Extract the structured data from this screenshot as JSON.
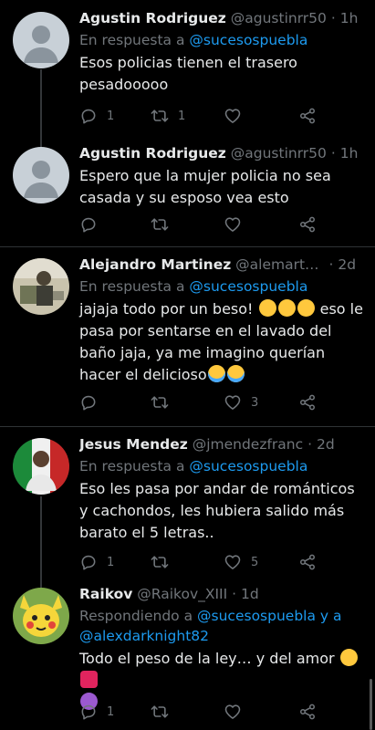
{
  "tweets": [
    {
      "name": "Agustin Rodriguez",
      "handle": "@agustinrr50",
      "sep": "·",
      "time": "1h",
      "reply_prefix": "En respuesta a",
      "reply_to": "@sucesospuebla",
      "text": "Esos policias tienen el trasero pesadooooo",
      "replies": "1",
      "retweets": "1",
      "likes": ""
    },
    {
      "name": "Agustin Rodriguez",
      "handle": "@agustinrr50",
      "sep": "·",
      "time": "1h",
      "text": "Espero que  la mujer policia no sea casada y su esposo vea esto",
      "replies": "",
      "retweets": "",
      "likes": ""
    },
    {
      "name": "Alejandro Martinez",
      "handle": "@alemart…",
      "sep": "·",
      "time": "2d",
      "reply_prefix": "En respuesta a",
      "reply_to": "@sucesospuebla",
      "text_a": "jajaja todo por un beso! ",
      "text_b": " eso le pasa por sentarse en el lavado del baño jaja, ya me imagino querían hacer el delicioso",
      "replies": "",
      "retweets": "",
      "likes": "3"
    },
    {
      "name": "Jesus Mendez",
      "handle": "@jmendezfranc",
      "sep": "·",
      "time": "2d",
      "reply_prefix": "En respuesta a",
      "reply_to": "@sucesospuebla",
      "text": "Eso les pasa por andar de románticos y cachondos, les hubiera salido más barato el 5 letras..",
      "replies": "1",
      "retweets": "",
      "likes": "5"
    },
    {
      "name": "Raikov",
      "handle": "@Raikov_XIII",
      "sep": "·",
      "time": "1d",
      "reply_prefix": "Respondiendo a",
      "reply_to": "@sucesospuebla y a",
      "reply_to_2": "@alexdarknight82",
      "text": "Todo el peso de la ley… y del amor ",
      "replies": "1",
      "retweets": "",
      "likes": ""
    }
  ],
  "icons": [
    "reply-icon",
    "retweet-icon",
    "like-icon",
    "share-icon"
  ],
  "colors": {
    "background": "#000000",
    "text": "#e7e9ea",
    "muted": "#71767b",
    "link": "#1d9bf0",
    "divider": "#2f3336"
  }
}
